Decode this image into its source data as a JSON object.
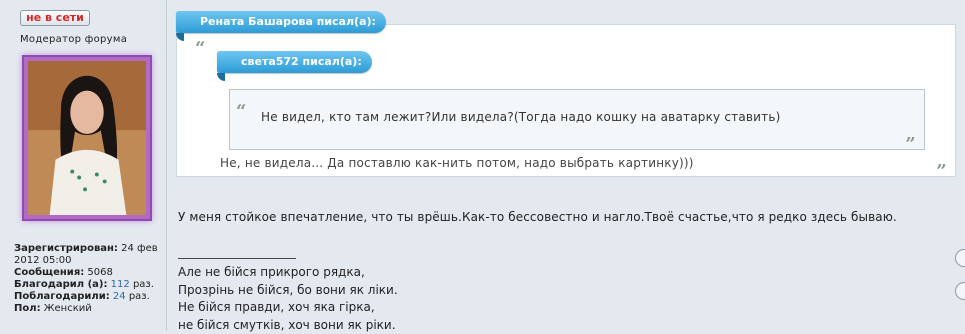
{
  "author": {
    "status_label": "не в сети",
    "title": "Модератор форума",
    "stats": {
      "registered_label": "Зарегистрирован:",
      "registered_value_line1": "24 фев",
      "registered_value_line2": "2012 05:00",
      "messages_label": "Сообщения:",
      "messages_value": "5068",
      "thanked_label": "Благодарил (а):",
      "thanked_value": "112",
      "thanked_unit": "раз.",
      "thanked_by_label": "Поблагодарили:",
      "thanked_by_value": "24",
      "thanked_by_unit": "раз.",
      "gender_label": "Пол:",
      "gender_value": "Женский"
    }
  },
  "post": {
    "outer_quote": {
      "author_label": "Рената Башарова писал(а):",
      "text": "Не, не видела... Да поставлю как-нить потом, надо выбрать картинку)))"
    },
    "inner_quote": {
      "author_label": "света572 писал(а):",
      "text": "Не видел, кто там лежит?Или видела?(Тогда надо кошку на аватарку ставить)"
    },
    "open_quote_glyph": "“",
    "close_quote_glyph": "„",
    "body": "У меня стойкое впечатление, что ты врёшь.Как-то бессовестно и нагло.Твоё счастье,что я редко здесь бываю.",
    "signature": [
      "Але не бійся прикрого рядка,",
      "Прозрінь не бійся, бо вони як ліки.",
      "Не бійся правди, хоч яка гірка,",
      "не бійся смутків, хоч вони як ріки."
    ]
  },
  "colors": {
    "accent_tag": "#2c9bd6",
    "status_offline": "#d62828",
    "avatar_frame": "#b16bc4"
  }
}
